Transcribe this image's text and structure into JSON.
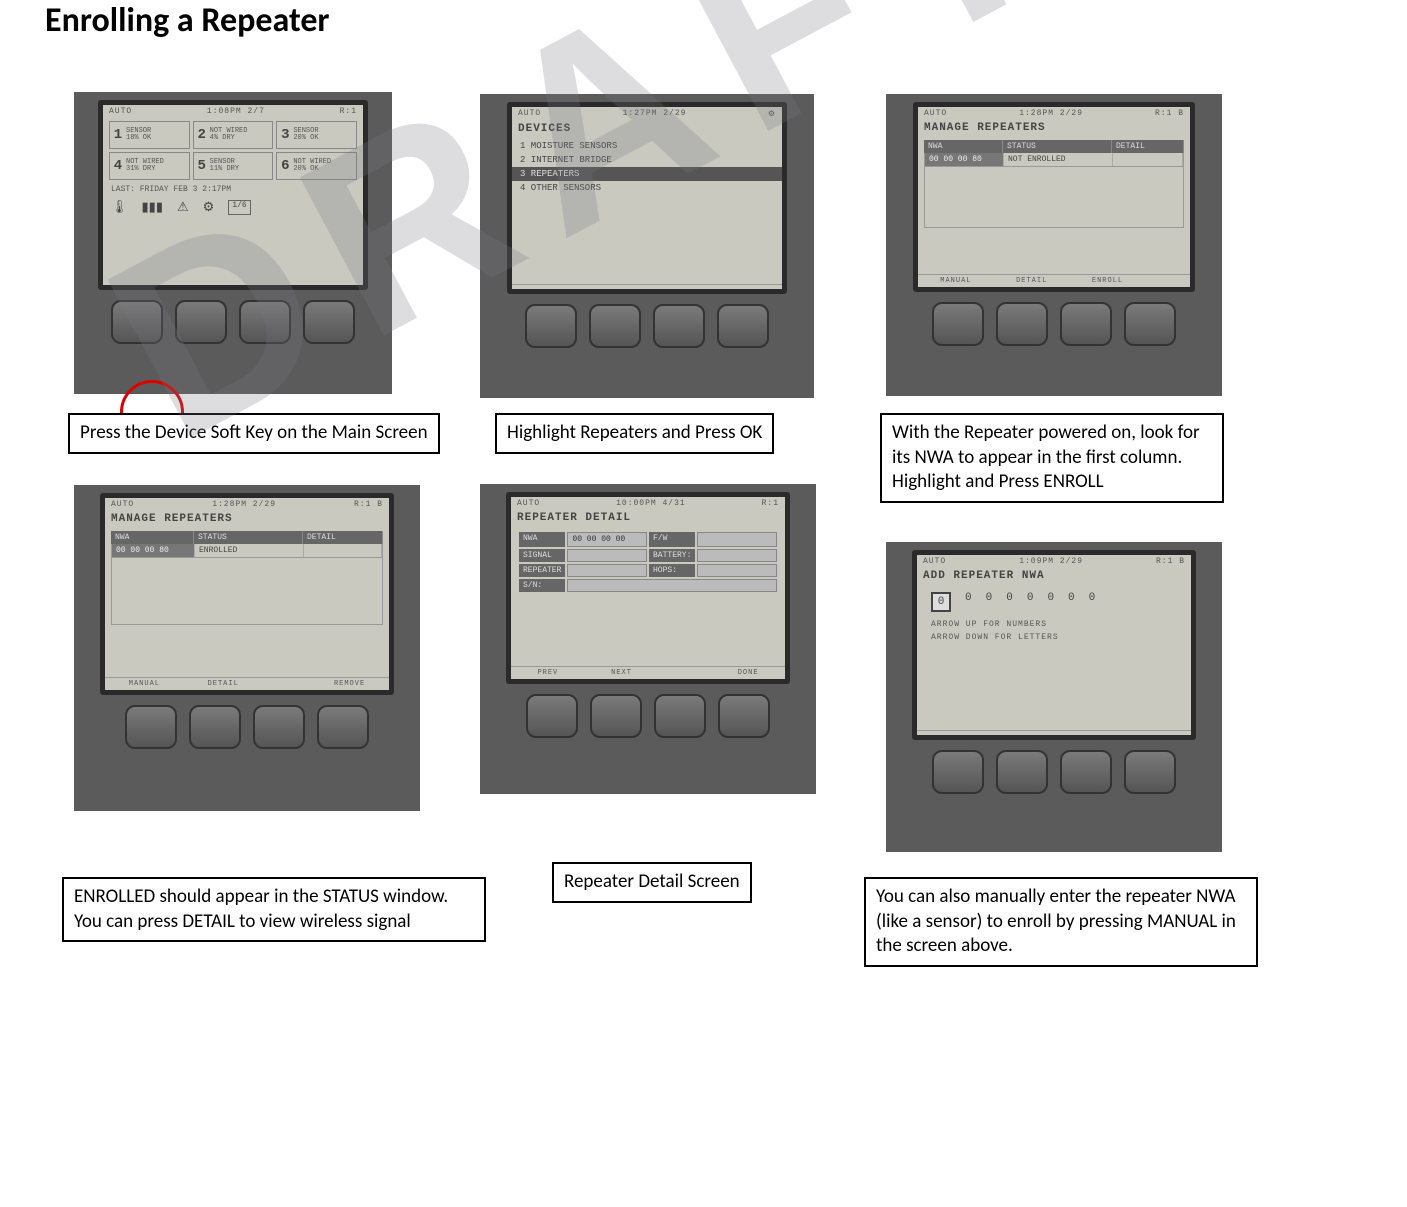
{
  "title": "Enrolling a Repeater",
  "watermark": "DRAFT",
  "captions": {
    "p1": "Press the Device Soft Key on the Main Screen",
    "p2": "Highlight Repeaters and Press OK",
    "p3": "With the Repeater powered on, look for its NWA to appear in the first column. Highlight and Press ENROLL",
    "p4": "ENROLLED should appear in the STATUS window. You can press DETAIL to view wireless signal",
    "p5": "Repeater Detail Screen",
    "p6": "You can also manually enter the repeater NWA (like a sensor) to enroll by pressing MANUAL in the screen above."
  },
  "panel1": {
    "mode": "AUTO",
    "time": "1:08PM 2/7",
    "rval": "R:1",
    "zones": [
      {
        "n": "1",
        "l1": "SENSOR",
        "l2": "18% OK"
      },
      {
        "n": "2",
        "l1": "NOT WIRED",
        "l2": "4% DRY"
      },
      {
        "n": "3",
        "l1": "SENSOR",
        "l2": "20% OK"
      },
      {
        "n": "4",
        "l1": "NOT WIRED",
        "l2": "31% DRY"
      },
      {
        "n": "5",
        "l1": "SENSOR",
        "l2": "11% DRY"
      },
      {
        "n": "6",
        "l1": "NOT WIRED",
        "l2": "20% OK"
      }
    ],
    "last": "LAST: FRIDAY   FEB 3   2:17PM",
    "icons": [
      "thermo",
      "signal",
      "warn",
      "gear",
      "page"
    ]
  },
  "panel2": {
    "mode": "AUTO",
    "time": "1:27PM 2/29",
    "title": "DEVICES",
    "items": [
      {
        "label": "1 MOISTURE SENSORS",
        "sel": false
      },
      {
        "label": "2 INTERNET BRIDGE",
        "sel": false
      },
      {
        "label": "3 REPEATERS",
        "sel": true
      },
      {
        "label": "4 OTHER SENSORS",
        "sel": false
      }
    ]
  },
  "panel3": {
    "mode": "AUTO",
    "time": "1:28PM 2/29",
    "rval": "R:1 B",
    "title": "MANAGE REPEATERS",
    "cols": [
      "NWA",
      "STATUS",
      "DETAIL"
    ],
    "row": {
      "nwa": "00 00 00 80",
      "status": "NOT ENROLLED",
      "detail": ""
    },
    "softkeys": [
      "MANUAL",
      "DETAIL",
      "ENROLL",
      ""
    ]
  },
  "panel4": {
    "mode": "AUTO",
    "time": "1:28PM 2/29",
    "rval": "R:1 B",
    "title": "MANAGE REPEATERS",
    "cols": [
      "NWA",
      "STATUS",
      "DETAIL"
    ],
    "row": {
      "nwa": "00 00 00 80",
      "status": "ENROLLED",
      "detail": ""
    },
    "softkeys": [
      "MANUAL",
      "DETAIL",
      "",
      "REMOVE"
    ]
  },
  "panel5": {
    "mode": "AUTO",
    "time": "10:00PM 4/31",
    "rval": "R:1",
    "title": "REPEATER DETAIL",
    "fields": {
      "NWA": "00 00 00 00",
      "F/W": "",
      "SIGNAL": "",
      "BATTERY:": "",
      "REPEATER": "",
      "HOPS:": "",
      "S/N:": ""
    },
    "softkeys": [
      "PREV",
      "NEXT",
      "",
      "DONE"
    ]
  },
  "panel6": {
    "mode": "AUTO",
    "time": "1:09PM 2/29",
    "rval": "R:1 B",
    "title": "ADD REPEATER NWA",
    "digits": [
      "0",
      "0",
      "0",
      "0",
      "0",
      "0",
      "0",
      "0"
    ],
    "hint1": "ARROW UP FOR NUMBERS",
    "hint2": "ARROW DOWN FOR LETTERS"
  }
}
